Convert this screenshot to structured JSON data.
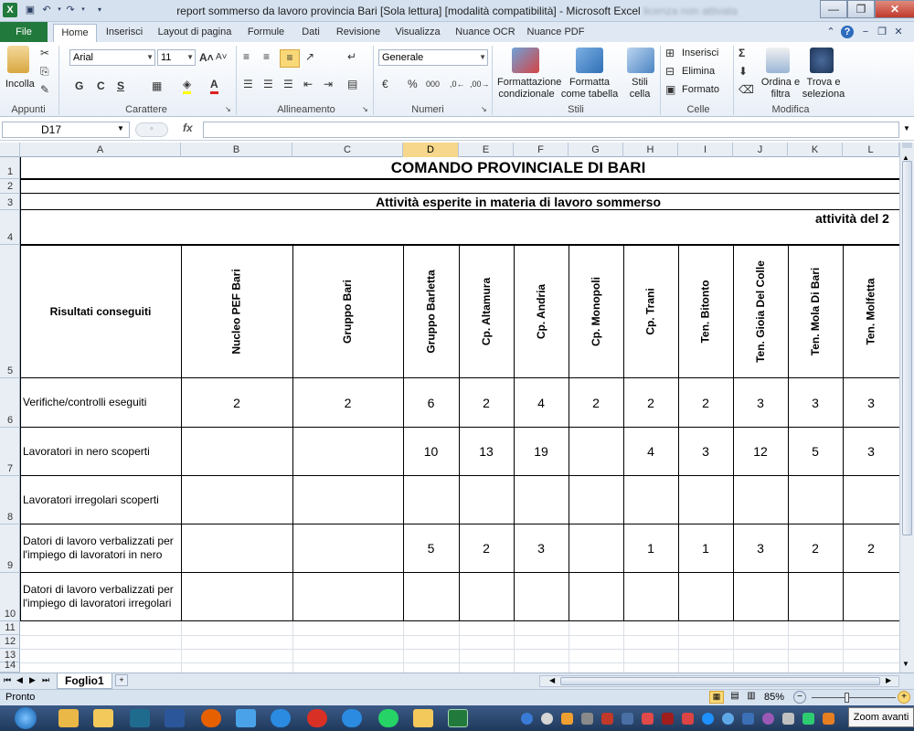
{
  "window": {
    "title_main": "report sommerso da lavoro provincia Bari  [Sola lettura]  [modalità compatibilità] - Microsoft Excel",
    "title_tail": "licenza non attivata"
  },
  "tabs": [
    "File",
    "Home",
    "Inserisci",
    "Layout di pagina",
    "Formule",
    "Dati",
    "Revisione",
    "Visualizza",
    "Nuance OCR",
    "Nuance PDF"
  ],
  "ribbon": {
    "clipboard": {
      "paste": "Incolla",
      "label": "Appunti"
    },
    "font": {
      "name": "Arial",
      "size": "11",
      "bold": "G",
      "italic": "C",
      "underline": "S",
      "label": "Carattere"
    },
    "alignment": {
      "label": "Allineamento"
    },
    "number": {
      "format": "Generale",
      "percent": "%",
      "thousands": "000",
      "label": "Numeri"
    },
    "styles": {
      "cond_format": "Formattazione condizionale",
      "table_format": "Formatta come tabella",
      "cell_styles": "Stili cella",
      "label": "Stili"
    },
    "cells": {
      "insert": "Inserisci",
      "delete": "Elimina",
      "format": "Formato",
      "label": "Celle"
    },
    "editing": {
      "sort": "Ordina e filtra",
      "find": "Trova e seleziona",
      "label": "Modifica"
    }
  },
  "formula_bar": {
    "name_box": "D17",
    "fx": "fx",
    "value": ""
  },
  "columns": [
    "A",
    "B",
    "C",
    "D",
    "E",
    "F",
    "G",
    "H",
    "I",
    "J",
    "K",
    "L"
  ],
  "selected_column": "D",
  "rows": [
    "1",
    "2",
    "3",
    "4",
    "5",
    "6",
    "7",
    "8",
    "9",
    "10",
    "11",
    "12",
    "13",
    "14"
  ],
  "sheet": {
    "title": "COMANDO PROVINCIALE DI BARI",
    "subtitle": "Attività esperite in materia di lavoro sommerso",
    "period": "attività del 2",
    "corner_label": "Risultati conseguiti",
    "units": [
      "Nucleo PEF Bari",
      "Gruppo Bari",
      "Gruppo Barletta",
      "Cp. Altamura",
      "Cp. Andria",
      "Cp. Monopoli",
      "Cp. Trani",
      "Ten. Bitonto",
      "Ten. Gioia Del Colle",
      "Ten. Mola Di Bari",
      "Ten. Molfetta"
    ],
    "data_rows": [
      {
        "label": "Verifiche/controlli eseguiti",
        "values": [
          "2",
          "2",
          "6",
          "2",
          "4",
          "2",
          "2",
          "2",
          "3",
          "3",
          "3"
        ]
      },
      {
        "label": "Lavoratori in nero scoperti",
        "values": [
          "",
          "",
          "10",
          "13",
          "19",
          "",
          "4",
          "3",
          "12",
          "5",
          "3"
        ]
      },
      {
        "label": "Lavoratori irregolari scoperti",
        "values": [
          "",
          "",
          "",
          "",
          "",
          "",
          "",
          "",
          "",
          "",
          ""
        ]
      },
      {
        "label": "Datori di lavoro verbalizzati per l'impiego di lavoratori in nero",
        "values": [
          "",
          "",
          "5",
          "2",
          "3",
          "",
          "1",
          "1",
          "3",
          "2",
          "2"
        ]
      },
      {
        "label": "Datori di lavoro verbalizzati per l'impiego di lavoratori irregolari",
        "values": [
          "",
          "",
          "",
          "",
          "",
          "",
          "",
          "",
          "",
          "",
          ""
        ]
      }
    ]
  },
  "sheet_tabs": [
    "Foglio1"
  ],
  "status": {
    "ready": "Pronto",
    "zoom": "85%",
    "tooltip": "Zoom avanti"
  },
  "colors": {
    "excel_green": "#217a3c",
    "selected_header": "#f6d78b",
    "ribbon_bg": "#e9eff7"
  }
}
